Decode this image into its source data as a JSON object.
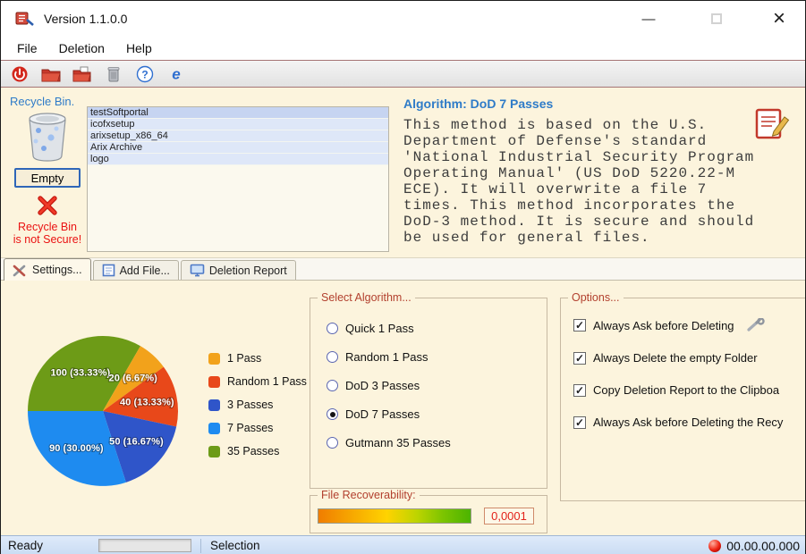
{
  "window": {
    "title": "Version 1.1.0.0",
    "minimize_glyph": "—",
    "close_glyph": "×"
  },
  "menu": {
    "items": [
      {
        "label": "File"
      },
      {
        "label": "Deletion"
      },
      {
        "label": "Help"
      }
    ]
  },
  "toolbar": {
    "buttons": [
      {
        "name": "exit-power-icon"
      },
      {
        "name": "open-folder-icon"
      },
      {
        "name": "add-folder-icon"
      },
      {
        "name": "recycle-trash-icon"
      },
      {
        "name": "help-icon"
      },
      {
        "name": "about-icon"
      }
    ]
  },
  "recycle_section": {
    "heading": "Recycle Bin.",
    "empty_button": "Empty",
    "warning_line1": "Recycle Bin",
    "warning_line2": "is not Secure!"
  },
  "file_list": {
    "items": [
      "testSoftportal",
      "icofxsetup",
      "arixsetup_x86_64",
      "Arix Archive",
      "logo"
    ]
  },
  "algorithm_panel": {
    "title": "Algorithm: DoD 7 Passes",
    "description": "This method is based on the U.S. Department of Defense's standard 'National Industrial Security Program Operating Manual' (US DoD 5220.22-M ECE). It will overwrite a file 7 times. This method incorporates the DoD-3 method. It is secure and should be used for general files."
  },
  "tabs": [
    {
      "label": "Settings..."
    },
    {
      "label": "Add File..."
    },
    {
      "label": "Deletion Report"
    }
  ],
  "chart_data": {
    "type": "pie",
    "title": "",
    "labels": [
      "1 Pass",
      "Random 1 Pass",
      "3 Passes",
      "7 Passes",
      "35 Passes"
    ],
    "values": [
      20,
      40,
      50,
      90,
      100
    ],
    "slice_labels": [
      "20 (6.67%)",
      "40 (13.33%)",
      "50 (16.67%)",
      "90 (30.00%)",
      "100 (33.33%)"
    ],
    "colors": [
      "#F2A21B",
      "#E8481A",
      "#2F55C9",
      "#1E8BF0",
      "#6D9B17"
    ],
    "legend_position": "right",
    "draw_order": [
      4,
      0,
      1,
      2,
      3
    ],
    "start_angle_deg": 180
  },
  "algorithm_group": {
    "title": "Select Algorithm...",
    "options": [
      {
        "label": "Quick 1 Pass",
        "selected": false
      },
      {
        "label": "Random 1 Pass",
        "selected": false
      },
      {
        "label": "DoD 3 Passes",
        "selected": false
      },
      {
        "label": "DoD 7 Passes",
        "selected": true
      },
      {
        "label": "Gutmann 35 Passes",
        "selected": false
      }
    ]
  },
  "recoverability": {
    "title": "File Recoverability:",
    "value": "0,0001"
  },
  "options_group": {
    "title": "Options...",
    "checkboxes": [
      {
        "label": "Always Ask before Deleting",
        "checked": true,
        "wrench_icon": true
      },
      {
        "label": "Always Delete the empty Folder",
        "checked": true
      },
      {
        "label": "Copy Deletion Report to the Clipboa",
        "checked": true
      },
      {
        "label": "Always Ask before Deleting the Recy",
        "checked": true
      }
    ]
  },
  "statusbar": {
    "ready": "Ready",
    "selection": "Selection",
    "timer": "00.00.00.000"
  }
}
